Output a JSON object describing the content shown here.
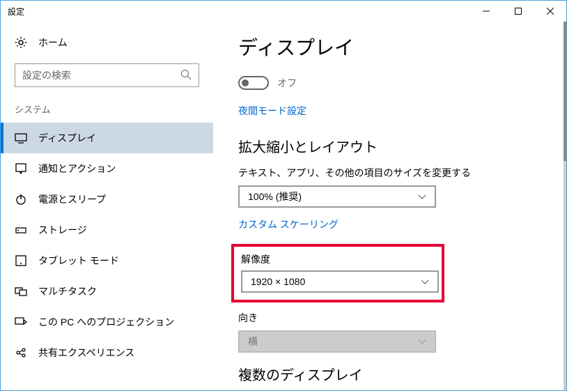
{
  "window": {
    "title": "設定"
  },
  "sidebar": {
    "home_label": "ホーム",
    "search_placeholder": "設定の検索",
    "category_label": "システム",
    "items": [
      {
        "label": "ディスプレイ",
        "selected": true
      },
      {
        "label": "通知とアクション"
      },
      {
        "label": "電源とスリープ"
      },
      {
        "label": "ストレージ"
      },
      {
        "label": "タブレット モード"
      },
      {
        "label": "マルチタスク"
      },
      {
        "label": "この PC へのプロジェクション"
      },
      {
        "label": "共有エクスペリエンス"
      }
    ]
  },
  "main": {
    "title": "ディスプレイ",
    "night_toggle_state": "オフ",
    "night_settings_link": "夜間モード設定",
    "scaling_section": "拡大縮小とレイアウト",
    "text_size_label": "テキスト、アプリ、その他の項目のサイズを変更する",
    "text_size_value": "100% (推奨)",
    "custom_scaling_link": "カスタム スケーリング",
    "resolution_label": "解像度",
    "resolution_value": "1920 × 1080",
    "orientation_label": "向き",
    "orientation_value": "横",
    "multi_display_section": "複数のディスプレイ"
  }
}
